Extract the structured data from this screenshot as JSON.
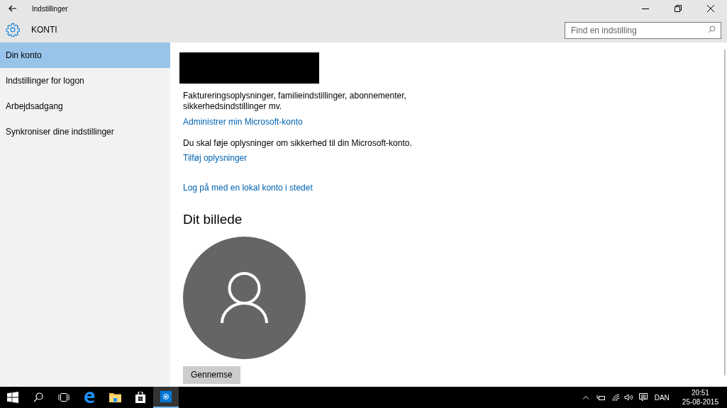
{
  "window": {
    "title": "Indstillinger"
  },
  "header": {
    "title": "KONTI",
    "search": {
      "placeholder": "Find en indstilling"
    }
  },
  "sidebar": {
    "items": [
      {
        "label": "Din konto",
        "selected": true
      },
      {
        "label": "Indstillinger for logon",
        "selected": false
      },
      {
        "label": "Arbejdsadgang",
        "selected": false
      },
      {
        "label": "Synkroniser dine indstillinger",
        "selected": false
      }
    ]
  },
  "account": {
    "name_redacted": true,
    "description": "Faktureringsoplysninger, familieindstillinger, abonnementer, sikkerhedsindstillinger mv.",
    "manage_link": "Administrer min Microsoft-konto",
    "security_notice": "Du skal føje oplysninger om sikkerhed til din Microsoft-konto.",
    "add_info_link": "Tilføj oplysninger",
    "local_account_link": "Log på med en lokal konto i stedet"
  },
  "picture_section": {
    "heading": "Dit billede",
    "browse_button": "Gennemse"
  },
  "taskbar": {
    "items": [
      {
        "kind": "start",
        "selected": false
      },
      {
        "kind": "search",
        "selected": false
      },
      {
        "kind": "taskview",
        "selected": false
      },
      {
        "kind": "edge",
        "selected": false
      },
      {
        "kind": "explorer",
        "selected": false
      },
      {
        "kind": "store",
        "selected": false
      },
      {
        "kind": "settings",
        "selected": true
      }
    ],
    "language": "DAN",
    "time": "20:51",
    "date": "25-08-2015"
  }
}
